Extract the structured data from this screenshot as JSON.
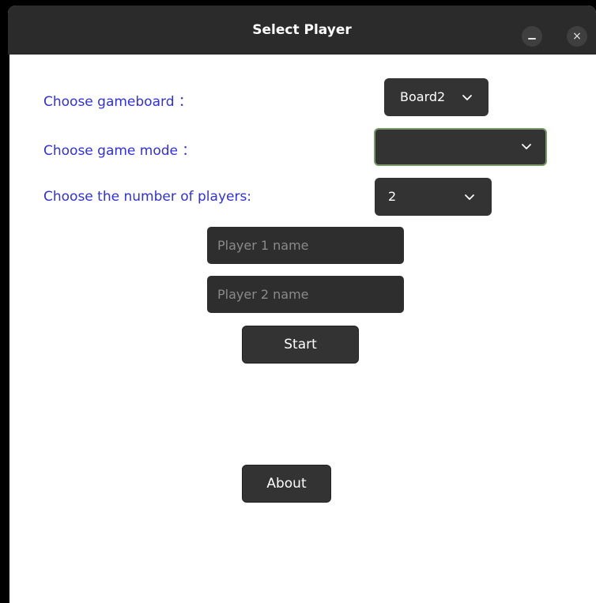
{
  "window": {
    "title": "Select Player",
    "minimize_glyph": "",
    "close_glyph": "×"
  },
  "form": {
    "gameboard_label": "Choose gameboard ：",
    "gameboard_value": "Board2",
    "gamemode_label": "Choose game mode ：",
    "gamemode_value": "",
    "players_label": "Choose the number of players:",
    "players_value": "2",
    "player1_placeholder": "Player 1 name",
    "player2_placeholder": "Player 2 name",
    "start_label": "Start",
    "about_label": "About"
  },
  "icons": {
    "dropdown": "chevron-down-icon",
    "minimize": "minimize-icon",
    "close": "close-icon"
  },
  "colors": {
    "label_text": "#2f2fe6",
    "titlebar": "#2b2b2b",
    "widget": "#333333",
    "focus_border": "#7a9a6a"
  }
}
